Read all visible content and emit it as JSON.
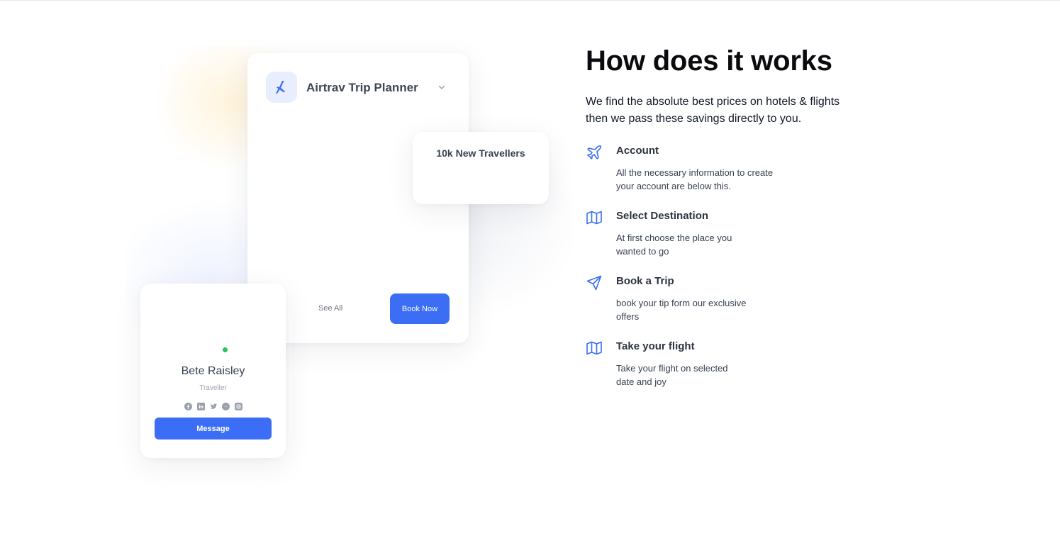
{
  "illustration": {
    "planner": {
      "title": "Airtrav Trip Planner",
      "logo_icon": "plane-icon",
      "see_all": "See All",
      "book_now": "Book Now"
    },
    "travellers_card": {
      "text": "10k New Travellers"
    },
    "profile": {
      "name": "Bete Raisley",
      "role": "Traveller",
      "social_icons": [
        "facebook-icon",
        "linkedin-icon",
        "twitter-icon",
        "messenger-icon",
        "instagram-icon"
      ],
      "message_label": "Message"
    }
  },
  "section": {
    "title": "How does it works",
    "lead_lines": [
      "We find the absolute best prices on hotels & flights",
      "then we pass these savings directly to you."
    ],
    "steps": [
      {
        "icon": "airplane-icon",
        "title": "Account",
        "desc_lines": [
          "All the necessary information to create",
          "your account are below this."
        ]
      },
      {
        "icon": "map-icon",
        "title": "Select Destination",
        "desc_lines": [
          "At first choose the place you",
          "wanted to go"
        ]
      },
      {
        "icon": "send-icon",
        "title": "Book a Trip",
        "desc_lines": [
          "book your tip form our exclusive",
          "offers"
        ]
      },
      {
        "icon": "map-icon",
        "title": "Take your flight",
        "desc_lines": [
          "Take your flight on selected",
          "date and joy"
        ]
      }
    ]
  },
  "colors": {
    "accent": "#3b6ef5",
    "online": "#22c55e",
    "heading": "#0b0b0f"
  }
}
